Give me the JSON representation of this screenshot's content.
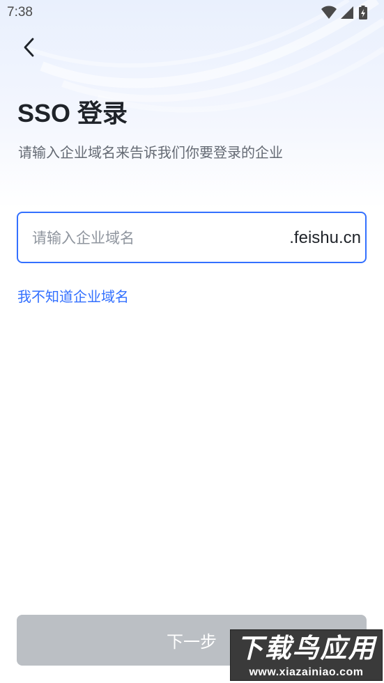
{
  "status_bar": {
    "time": "7:38",
    "icons": [
      "wifi-icon",
      "signal-icon",
      "battery-charging-icon"
    ]
  },
  "header": {
    "back_icon": "chevron-left-icon"
  },
  "page": {
    "title": "SSO 登录",
    "subtitle": "请输入企业域名来告诉我们你要登录的企业"
  },
  "domain_input": {
    "value": "",
    "placeholder": "请输入企业域名",
    "suffix": ".feishu.cn"
  },
  "help_link": "我不知道企业域名",
  "next_button": "下一步",
  "watermark": {
    "title": "下载鸟应用",
    "url": "www.xiazainiao.com"
  },
  "colors": {
    "accent": "#3370ff",
    "title_text": "#1f2329",
    "secondary_text": "#646a73",
    "placeholder": "#8f959e",
    "disabled_button": "#bbbfc4"
  }
}
